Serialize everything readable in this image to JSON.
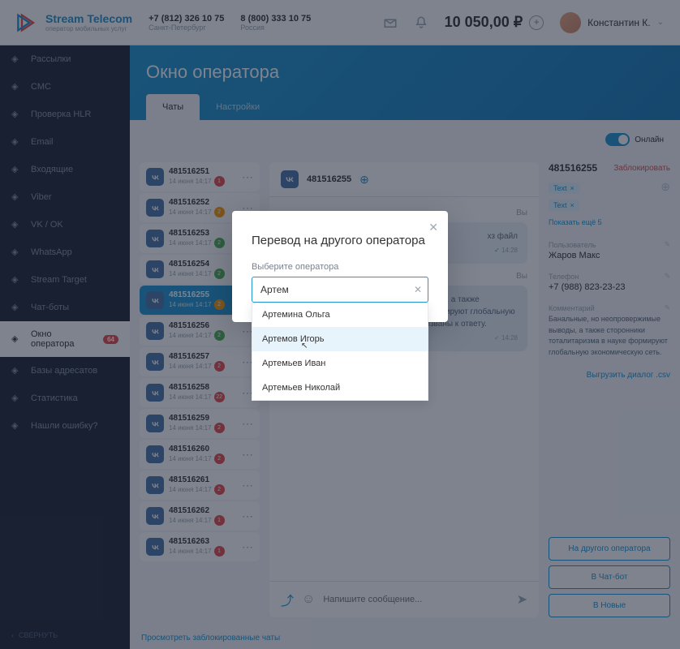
{
  "brand": {
    "title": "Stream Telecom",
    "subtitle": "оператор мобильных услуг"
  },
  "phones": [
    {
      "num": "+7 (812) 326 10 75",
      "loc": "Санкт-Петербург"
    },
    {
      "num": "8 (800) 333 10 75",
      "loc": "Россия"
    }
  ],
  "balance": "10 050,00 ₽",
  "user": "Константин К.",
  "nav": [
    {
      "icon": "mail",
      "label": "Рассылки"
    },
    {
      "icon": "chat",
      "label": "СМС"
    },
    {
      "icon": "check",
      "label": "Проверка HLR"
    },
    {
      "icon": "at",
      "label": "Email"
    },
    {
      "icon": "inbox",
      "label": "Входящие"
    },
    {
      "icon": "phone",
      "label": "Viber"
    },
    {
      "icon": "vk",
      "label": "VK / OK"
    },
    {
      "icon": "wa",
      "label": "WhatsApp"
    },
    {
      "icon": "target",
      "label": "Stream Target"
    },
    {
      "icon": "bot",
      "label": "Чат-боты"
    },
    {
      "icon": "op",
      "label": "Окно оператора",
      "active": true,
      "badge": "64"
    },
    {
      "icon": "db",
      "label": "Базы адресатов"
    },
    {
      "icon": "stats",
      "label": "Статистика"
    },
    {
      "icon": "bug",
      "label": "Нашли ошибку?"
    }
  ],
  "collapse": "СВЕРНУТЬ",
  "page_title": "Окно оператора",
  "tabs": [
    {
      "label": "Чаты",
      "active": true
    },
    {
      "label": "Настройки"
    }
  ],
  "online_label": "Онлайн",
  "chats": [
    {
      "id": "481516251",
      "date": "14 июня 14:17",
      "badge": "1",
      "color": "red"
    },
    {
      "id": "481516252",
      "date": "14 июня 14:17",
      "badge": "2",
      "color": "orange"
    },
    {
      "id": "481516253",
      "date": "14 июня 14:17",
      "badge": "2",
      "color": "green"
    },
    {
      "id": "481516254",
      "date": "14 июня 14:17",
      "badge": "2",
      "color": "green"
    },
    {
      "id": "481516255",
      "date": "14 июня 14:17",
      "badge": "2",
      "color": "orange",
      "active": true
    },
    {
      "id": "481516256",
      "date": "14 июня 14:17",
      "badge": "2",
      "color": "green"
    },
    {
      "id": "481516257",
      "date": "14 июня 14:17",
      "badge": "2",
      "color": "red"
    },
    {
      "id": "481516258",
      "date": "14 июня 14:17",
      "badge": "22",
      "color": "red"
    },
    {
      "id": "481516259",
      "date": "14 июня 14:17",
      "badge": "2",
      "color": "red"
    },
    {
      "id": "481516260",
      "date": "14 июня 14:17",
      "badge": "2",
      "color": "red"
    },
    {
      "id": "481516261",
      "date": "14 июня 14:17",
      "badge": "2",
      "color": "red"
    },
    {
      "id": "481516262",
      "date": "14 июня 14:17",
      "badge": "1",
      "color": "red"
    },
    {
      "id": "481516263",
      "date": "14 июня 14:17",
      "badge": "1",
      "color": "red"
    }
  ],
  "blocked_link": "Просмотреть заблокированные чаты",
  "current_chat_id": "481516255",
  "msg_from": "Вы",
  "msg_file": "хз файл",
  "msg_time": "14:28",
  "msg_text": "Банальные, но неопровержимые выводы, а также сторонники тоталитаризма в науке формируют глобальную экономическую сеть и при этом - призваны к ответу.",
  "input_placeholder": "Напишите сообщение...",
  "info": {
    "id": "481516255",
    "block": "Заблокировать",
    "tag": "Text",
    "show_more": "Показать ещё 5",
    "user_label": "Пользователь",
    "user_value": "Жаров Макс",
    "phone_label": "Телефон",
    "phone_value": "+7 (988) 823-23-23",
    "comment_label": "Комментарий",
    "comment_value": "Банальные, но неопровержимые выводы, а также сторонники тоталитаризма в науке формируют глобальную экономическую сеть.",
    "export": "Выгрузить диалог .csv"
  },
  "actions": [
    "На другого оператора",
    "В Чат-бот",
    "В Новые"
  ],
  "modal": {
    "title": "Перевод на другого оператора",
    "label": "Выберите оператора",
    "value": "Артем",
    "options": [
      "Артемина Ольга",
      "Артемов Игорь",
      "Артемьев Иван",
      "Артемьев Николай"
    ]
  }
}
